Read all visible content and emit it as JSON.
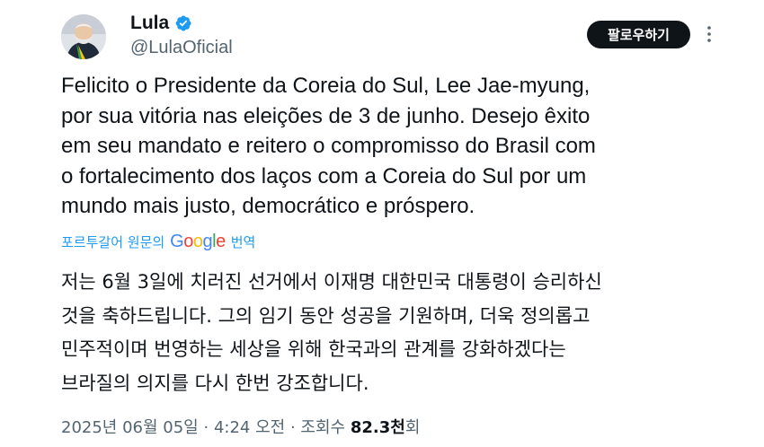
{
  "author": {
    "name": "Lula",
    "handle": "@LulaOficial",
    "verified": true
  },
  "follow_button": {
    "label": "팔로우하기"
  },
  "tweet": {
    "lines": [
      "Felicito o Presidente da Coreia do Sul, Lee Jae-myung,",
      "por sua vitória nas eleições de 3 de junho. Desejo êxito",
      "em seu mandato e reitero o compromisso do Brasil com",
      "o fortalecimento dos laços com a Coreia do Sul por um",
      "mundo mais justo, democrático e próspero."
    ]
  },
  "translation": {
    "prefix": "포르투갈어 원문의",
    "provider": "Google",
    "suffix": "번역",
    "lines": [
      "저는 6월 3일에 치러진 선거에서 이재명 대한민국 대통령이 승리하신",
      "것을 축하드립니다. 그의 임기 동안 성공을 기원하며, 더욱 정의롭고",
      "민주적이며 번영하는 세상을 위해 한국과의 관계를 강화하겠다는",
      "브라질의 의지를 다시 한번 강조합니다."
    ]
  },
  "meta": {
    "date": "2025년 06월 05일",
    "time": "4:24 오전",
    "views_label": "조회수",
    "views_count": "82.3천",
    "views_suffix": "회",
    "separator": "·"
  },
  "icons": {
    "verified": "verified-badge-icon",
    "more": "more-options-icon"
  },
  "colors": {
    "verified": "#1d9bf0",
    "link": "#1d9bf0",
    "button_bg": "#0f1419",
    "secondary_text": "#536471"
  }
}
